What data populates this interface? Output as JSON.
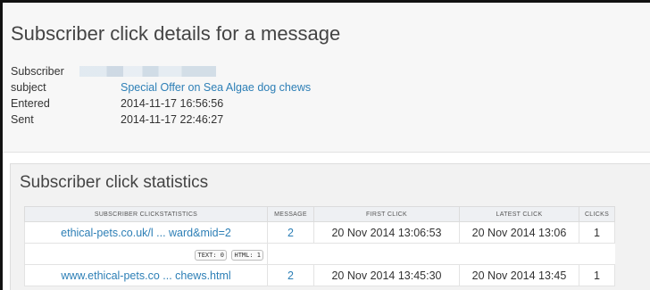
{
  "page": {
    "title": "Subscriber click details for a message"
  },
  "details": {
    "subscriber_label": "Subscriber",
    "subject_label": "subject",
    "subject_value": "Special Offer on Sea Algae dog chews",
    "entered_label": "Entered",
    "entered_value": "2014-11-17 16:56:56",
    "sent_label": "Sent",
    "sent_value": "2014-11-17 22:46:27"
  },
  "stats": {
    "title": "Subscriber click statistics",
    "columns": [
      "SUBSCRIBER CLICKSTATISTICS",
      "MESSAGE",
      "FIRST CLICK",
      "LATEST CLICK",
      "CLICKS"
    ],
    "rows": [
      {
        "link": "ethical-pets.co.uk/l ... ward&mid=2",
        "message": "2",
        "first_click": "20 Nov 2014 13:06:53",
        "latest_click": "20 Nov 2014 13:06",
        "clicks": "1",
        "text_tag": "TEXT: 0",
        "html_tag": "HTML: 1"
      },
      {
        "link": "www.ethical-pets.co ... chews.html",
        "message": "2",
        "first_click": "20 Nov 2014 13:45:30",
        "latest_click": "20 Nov 2014 13:45",
        "clicks": "1"
      }
    ]
  }
}
